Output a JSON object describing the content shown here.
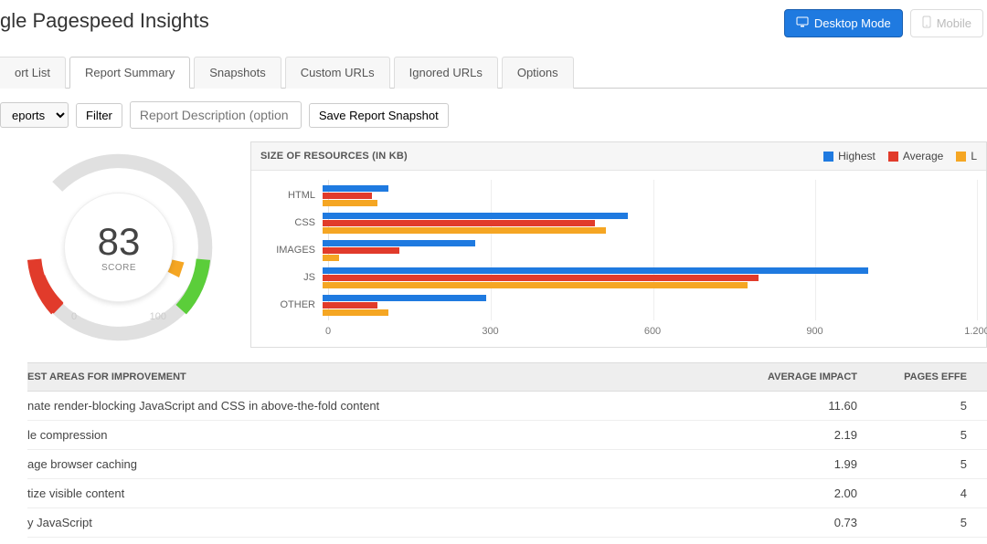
{
  "header": {
    "title": "gle Pagespeed Insights",
    "desktop_mode_label": "Desktop Mode",
    "mobile_mode_label": "Mobile"
  },
  "tabs": [
    {
      "label": "ort List"
    },
    {
      "label": "Report Summary",
      "active": true
    },
    {
      "label": "Snapshots"
    },
    {
      "label": "Custom URLs"
    },
    {
      "label": "Ignored URLs"
    },
    {
      "label": "Options"
    }
  ],
  "toolbar": {
    "reports_select_label": "eports",
    "filter_label": "Filter",
    "description_placeholder": "Report Description (option",
    "save_snapshot_label": "Save Report Snapshot"
  },
  "gauge": {
    "score": "83",
    "score_label": "SCORE",
    "tick_min": "0",
    "tick_max": "100"
  },
  "chart": {
    "title": "SIZE OF RESOURCES (IN KB)",
    "legend": {
      "highest": "Highest",
      "average": "Average",
      "low": "L"
    },
    "x_ticks": [
      "0",
      "300",
      "600",
      "900",
      "1.200"
    ]
  },
  "chart_data": {
    "type": "bar",
    "orientation": "horizontal",
    "categories": [
      "HTML",
      "CSS",
      "IMAGES",
      "JS",
      "OTHER"
    ],
    "series": [
      {
        "name": "Highest",
        "color": "#1f7ae0",
        "values": [
          120,
          560,
          280,
          1000,
          300
        ]
      },
      {
        "name": "Average",
        "color": "#e13b2b",
        "values": [
          90,
          500,
          140,
          800,
          100
        ]
      },
      {
        "name": "L",
        "color": "#f5a623",
        "values": [
          100,
          520,
          30,
          780,
          120
        ]
      }
    ],
    "title": "SIZE OF RESOURCES (IN KB)",
    "xlabel": "",
    "ylabel": "",
    "xlim": [
      0,
      1200
    ]
  },
  "table": {
    "headers": {
      "area": "EST AREAS FOR IMPROVEMENT",
      "impact": "AVERAGE IMPACT",
      "pages": "PAGES EFFE"
    },
    "rows": [
      {
        "area": "nate render-blocking JavaScript and CSS in above-the-fold content",
        "impact": "11.60",
        "pages": "5"
      },
      {
        "area": "le compression",
        "impact": "2.19",
        "pages": "5"
      },
      {
        "area": "age browser caching",
        "impact": "1.99",
        "pages": "5"
      },
      {
        "area": "tize visible content",
        "impact": "2.00",
        "pages": "4"
      },
      {
        "area": "y JavaScript",
        "impact": "0.73",
        "pages": "5"
      }
    ]
  }
}
